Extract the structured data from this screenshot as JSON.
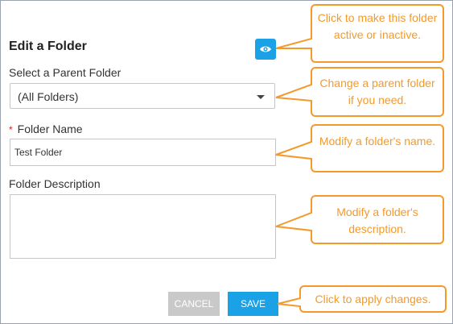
{
  "form": {
    "title": "Edit a Folder",
    "parent_folder_label": "Select a Parent Folder",
    "parent_folder_value": "(All Folders)",
    "required_mark": "*",
    "folder_name_label": "Folder Name",
    "folder_name_value": "Test Folder",
    "folder_description_label": "Folder Description",
    "folder_description_value": "",
    "cancel_label": "CANCEL",
    "save_label": "SAVE",
    "active_toggle_icon": "eye-icon"
  },
  "callouts": {
    "toggle": "Click to make this folder active or inactive.",
    "parent": "Change a parent folder if you need.",
    "name": "Modify a folder's name.",
    "description": "Modify a folder's description.",
    "save": "Click to apply changes."
  },
  "colors": {
    "accent": "#1aa1e6",
    "callout": "#f39a2b",
    "required": "#d0202a"
  }
}
